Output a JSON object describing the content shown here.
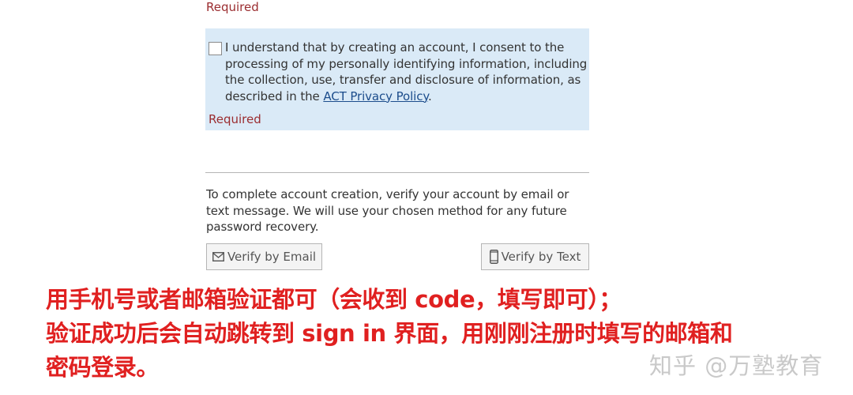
{
  "form": {
    "required_label_top": "Required",
    "consent": {
      "text_before_link": "I understand that by creating an account, I consent to the processing of my personally identifying information, including the collection, use, transfer and disclosure of information, as described in the ",
      "link_text": "ACT Privacy Policy",
      "text_after_link": ".",
      "required_label": "Required",
      "checked": false
    },
    "verification_instructions": "To complete account creation, verify your account by email or text message. We will use your chosen method for any future password recovery.",
    "verify_email_label": "Verify by Email",
    "verify_text_label": "Verify by Text",
    "verify_email_icon": "envelope-icon",
    "verify_text_icon": "mobile-phone-icon"
  },
  "annotation": {
    "line1": "用手机号或者邮箱验证都可（会收到 code，填写即可）；",
    "line2": "验证成功后会自动跳转到 sign in 界面，用刚刚注册时填写的邮箱和",
    "line3": "密码登录。"
  },
  "watermark": "知乎 @万塾教育",
  "colors": {
    "required_red": "#9b2d30",
    "consent_bg": "#daeaf7",
    "link_blue": "#1c4d8c",
    "annotation_red": "#e02020",
    "watermark_gray": "#c9c9c9"
  }
}
